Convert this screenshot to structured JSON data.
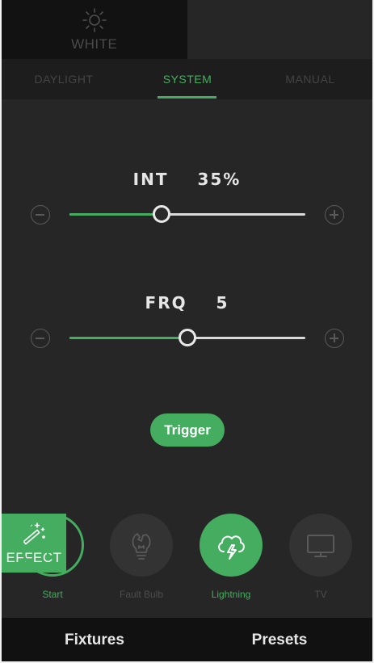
{
  "mode_tabs": [
    {
      "label": "WHITE",
      "icon": "sun-icon",
      "active": false
    },
    {
      "label": "EFFECT",
      "icon": "magic-wand-icon",
      "active": true
    }
  ],
  "sub_tabs": [
    {
      "label": "DAYLIGHT",
      "active": false
    },
    {
      "label": "SYSTEM",
      "active": true
    },
    {
      "label": "MANUAL",
      "active": false
    }
  ],
  "intensity": {
    "label": "INT",
    "value_text": "35%",
    "level": 0.39
  },
  "frequency": {
    "label": "FRQ",
    "value_text": "5",
    "level": 0.5
  },
  "trigger_label": "Trigger",
  "effects": [
    {
      "label": "Start",
      "icon": "play-icon",
      "state": "outline"
    },
    {
      "label": "Fault Bulb",
      "icon": "broken-bulb-icon",
      "state": "disabled"
    },
    {
      "label": "Lightning",
      "icon": "cloud-lightning-icon",
      "state": "active"
    },
    {
      "label": "TV",
      "icon": "tv-icon",
      "state": "disabled"
    }
  ],
  "bottom_nav": {
    "fixtures": "Fixtures",
    "presets": "Presets"
  },
  "colors": {
    "accent": "#44ad5f",
    "background": "#262626",
    "dark": "#121212"
  }
}
